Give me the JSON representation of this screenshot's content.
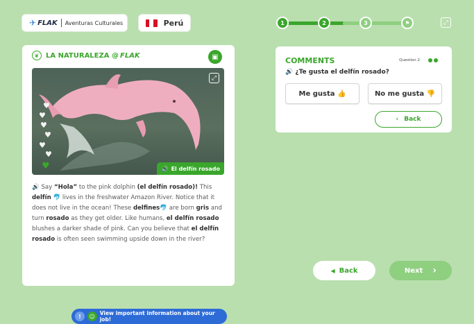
{
  "header": {
    "brand_logo": "FLAK",
    "brand_subtitle": "Aventuras Culturales",
    "country": "Perú",
    "flag_colors": [
      "#d91023",
      "#ffffff",
      "#d91023"
    ],
    "icons": [
      "airplane-icon",
      "peru-flag-icon",
      "fullscreen-icon"
    ]
  },
  "progress": {
    "steps": [
      "1",
      "2",
      "3"
    ],
    "current_step": 2,
    "final_icon": "flag-icon",
    "colors": {
      "done": "#3aa62c",
      "pending": "#8fcf80"
    }
  },
  "card": {
    "title": "LA NATURALEZA @",
    "title_logo": "FLAK",
    "photo_caption": "El delfín rosado",
    "hearts": [
      "♥",
      "♥",
      "♥",
      "♥",
      "♥",
      "♥",
      "♥"
    ],
    "story": [
      {
        "t": "Say ",
        "b": false
      },
      {
        "t": "“Hola”",
        "b": true
      },
      {
        "t": " to the pink dolphin ",
        "b": false
      },
      {
        "t": "(el delfín rosado)!",
        "b": true
      },
      {
        "t": " This ",
        "b": false
      },
      {
        "t": "delfín",
        "b": true
      },
      {
        "t": " 🐬 lives in the freshwater Amazon River. Notice that it does not live in the ocean! These ",
        "b": false
      },
      {
        "t": "delfines",
        "b": true
      },
      {
        "t": "🐬 are born ",
        "b": false
      },
      {
        "t": "gris",
        "b": true
      },
      {
        "t": " and turn ",
        "b": false
      },
      {
        "t": "rosado",
        "b": true
      },
      {
        "t": " as they get older. Like humans, ",
        "b": false
      },
      {
        "t": "el delfín rosado",
        "b": true
      },
      {
        "t": " blushes a darker shade of pink. Can you believe that ",
        "b": false
      },
      {
        "t": "el delfín rosado",
        "b": true
      },
      {
        "t": " is often seen swimming upside down in the river?",
        "b": false
      }
    ],
    "info_button": "View important information about your job!"
  },
  "comments": {
    "title": "COMMENTS",
    "question_num": "Question 2",
    "prompt": "¿Te gusta el delfín rosado?",
    "answers": [
      "Me gusta 👍",
      "No me gusta 👎"
    ],
    "back": "Back"
  },
  "nav": {
    "back": "Back",
    "next": "Next"
  }
}
